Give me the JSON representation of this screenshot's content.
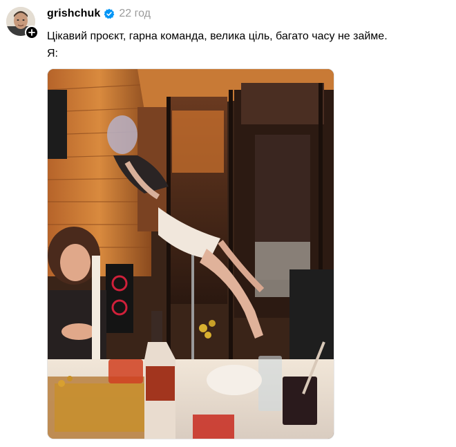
{
  "post": {
    "username": "grishchuk",
    "verified": true,
    "timestamp": "22 год",
    "caption_line1": "Цікавий проєкт, гарна команда, велика ціль, багато часу не займе.",
    "caption_line2": "Я:",
    "icons": {
      "verified": "verified-badge-icon",
      "follow": "plus-icon"
    },
    "colors": {
      "verified": "#0095f6",
      "timestamp": "#9a9a9a"
    }
  }
}
